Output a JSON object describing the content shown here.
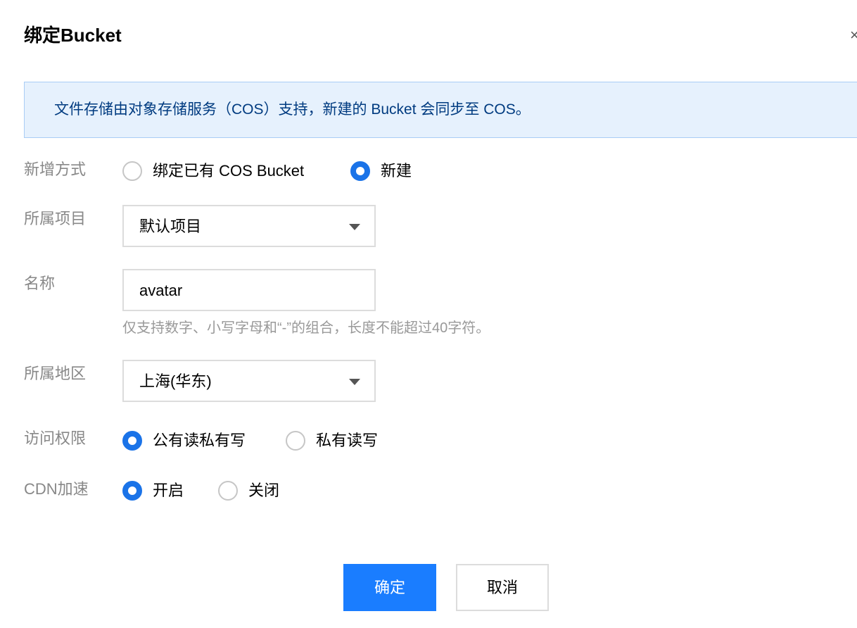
{
  "dialog": {
    "title": "绑定Bucket",
    "close_icon": "×"
  },
  "info_banner": {
    "text": "文件存储由对象存储服务（COS）支持，新建的 Bucket 会同步至 COS。"
  },
  "form": {
    "add_method": {
      "label": "新增方式",
      "options": [
        {
          "label": "绑定已有 COS Bucket",
          "checked": false
        },
        {
          "label": "新建",
          "checked": true
        }
      ]
    },
    "project": {
      "label": "所属项目",
      "selected": "默认项目"
    },
    "name": {
      "label": "名称",
      "value": "avatar",
      "hint": "仅支持数字、小写字母和“-”的组合，长度不能超过40字符。"
    },
    "region": {
      "label": "所属地区",
      "selected": "上海(华东)"
    },
    "access": {
      "label": "访问权限",
      "options": [
        {
          "label": "公有读私有写",
          "checked": true
        },
        {
          "label": "私有读写",
          "checked": false
        }
      ]
    },
    "cdn": {
      "label": "CDN加速",
      "options": [
        {
          "label": "开启",
          "checked": true
        },
        {
          "label": "关闭",
          "checked": false
        }
      ]
    }
  },
  "buttons": {
    "confirm": "确定",
    "cancel": "取消"
  },
  "colors": {
    "primary": "#1a7dff",
    "radio_checked": "#1a73e8",
    "banner_bg": "#e6f1fd",
    "banner_text": "#003b80"
  }
}
